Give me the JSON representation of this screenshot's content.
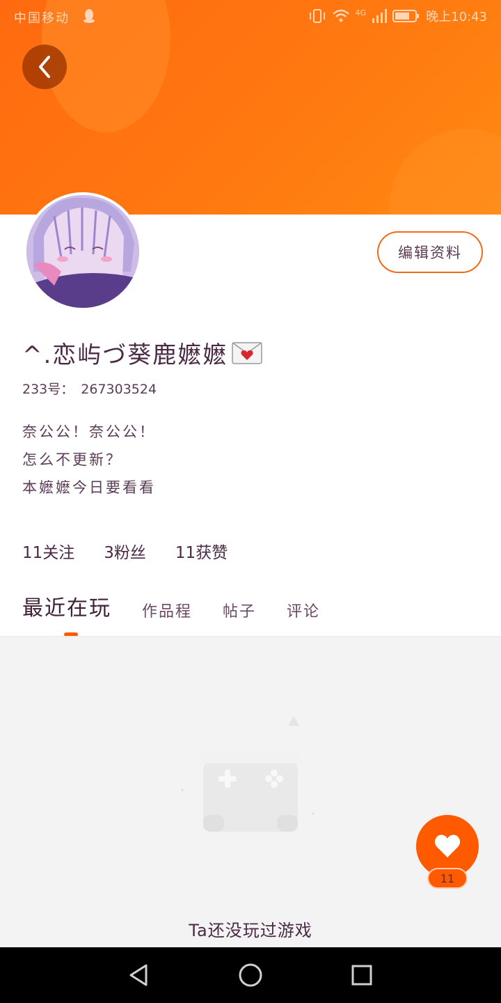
{
  "status_bar": {
    "carrier": "中国移动",
    "time": "晚上10:43",
    "network": "4G",
    "icons": [
      "qq-icon",
      "vibrate-icon",
      "wifi-icon",
      "signal-icon",
      "battery-icon"
    ]
  },
  "profile": {
    "nickname": "^.恋屿づ葵鹿嬷嬷",
    "nickname_emoji": "envelope-heart-icon",
    "uid_label": "233号：",
    "uid_value": "267303524",
    "bio_lines": [
      "奈公公！奈公公！",
      "怎么不更新？",
      "本嬷嬷今日要看看"
    ],
    "edit_button": "编辑资料"
  },
  "stats": {
    "follow": "11关注",
    "fans": "3粉丝",
    "likes": "11获赞"
  },
  "tabs": [
    {
      "label": "最近在玩",
      "active": true
    },
    {
      "label": "作品程",
      "active": false
    },
    {
      "label": "帖子",
      "active": false
    },
    {
      "label": "评论",
      "active": false
    }
  ],
  "empty_state": {
    "icon": "gamepad-icon",
    "text": "Ta还没玩过游戏"
  },
  "like_fab": {
    "icon": "heart-icon",
    "count": "11"
  },
  "colors": {
    "brand_orange": "#ff5a00",
    "header_orange": "#ff7410",
    "text_purple": "#4a2a45"
  },
  "nav_bar": {
    "buttons": [
      "back-triangle-icon",
      "home-circle-icon",
      "recents-square-icon"
    ]
  }
}
